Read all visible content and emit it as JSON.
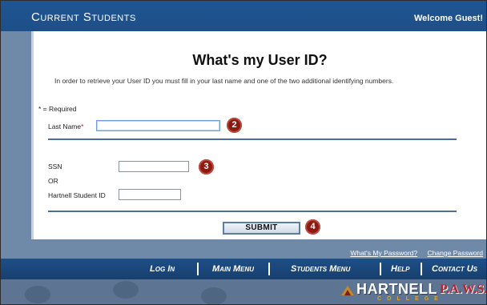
{
  "header": {
    "title": "Current Students",
    "welcome": "Welcome Guest!"
  },
  "form": {
    "heading": "What's my User ID?",
    "instructions": "In order to retrieve your User ID you must fill in your last name and one of the two additional identifying numbers.",
    "required_note": "* = Required",
    "last_name_label": "Last Name",
    "required_marker": "*",
    "last_name_value": "",
    "ssn_label": "SSN",
    "ssn_value": "",
    "or_label": "OR",
    "student_id_label": "Hartnell Student ID",
    "student_id_value": "",
    "submit_label": "SUBMIT"
  },
  "annotations": [
    "2",
    "3",
    "4"
  ],
  "footer": {
    "links": [
      "What's My Password?",
      "Change Password"
    ],
    "nav": [
      "Log In",
      "Main Menu",
      "Students Menu",
      "Help",
      "Contact Us"
    ],
    "logo": {
      "name": "HARTNELL",
      "sub": "COLLEGE",
      "paws": "P.A.W.S."
    }
  },
  "colors": {
    "header_bg": "#1d4f88",
    "footer_bg": "#6f8aa9",
    "badge_bg": "#8c1a13",
    "rule": "#4e6f95",
    "required_star": "#c8141e"
  }
}
